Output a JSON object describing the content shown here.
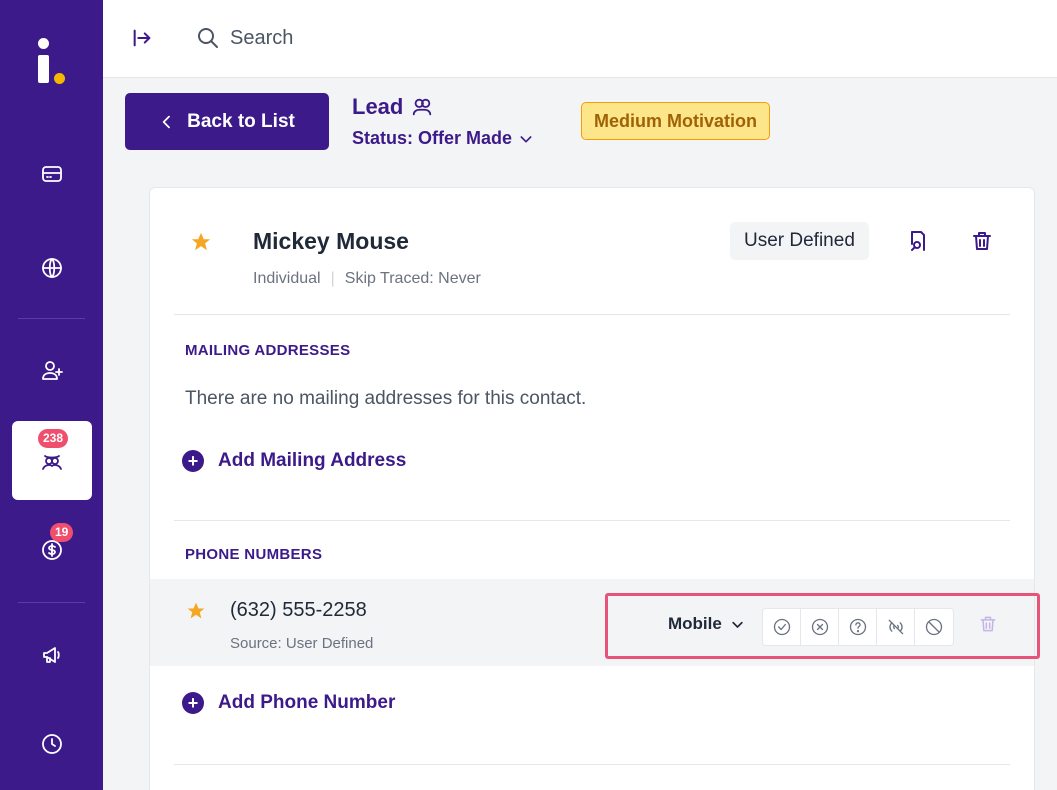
{
  "search": {
    "label": "Search"
  },
  "header": {
    "back_label": "Back to List",
    "lead_title": "Lead",
    "status_label": "Status: Offer Made",
    "motivation": "Medium Motivation"
  },
  "sidebar": {
    "badges": {
      "leads": "238",
      "deals": "19"
    }
  },
  "contact": {
    "name": "Mickey Mouse",
    "type": "Individual",
    "skip_traced": "Skip Traced: Never",
    "source_badge": "User Defined"
  },
  "mailing": {
    "title": "MAILING ADDRESSES",
    "empty_text": "There are no mailing addresses for this contact.",
    "add_label": "Add Mailing Address"
  },
  "phones": {
    "title": "PHONE NUMBERS",
    "items": [
      {
        "number": "(632) 555-2258",
        "source": "Source: User Defined",
        "type": "Mobile"
      }
    ],
    "add_label": "Add Phone Number"
  },
  "colors": {
    "brand": "#3d1a8a",
    "badge": "#ef4f6d",
    "star": "#f5a623",
    "highlight": "#e8537a"
  }
}
